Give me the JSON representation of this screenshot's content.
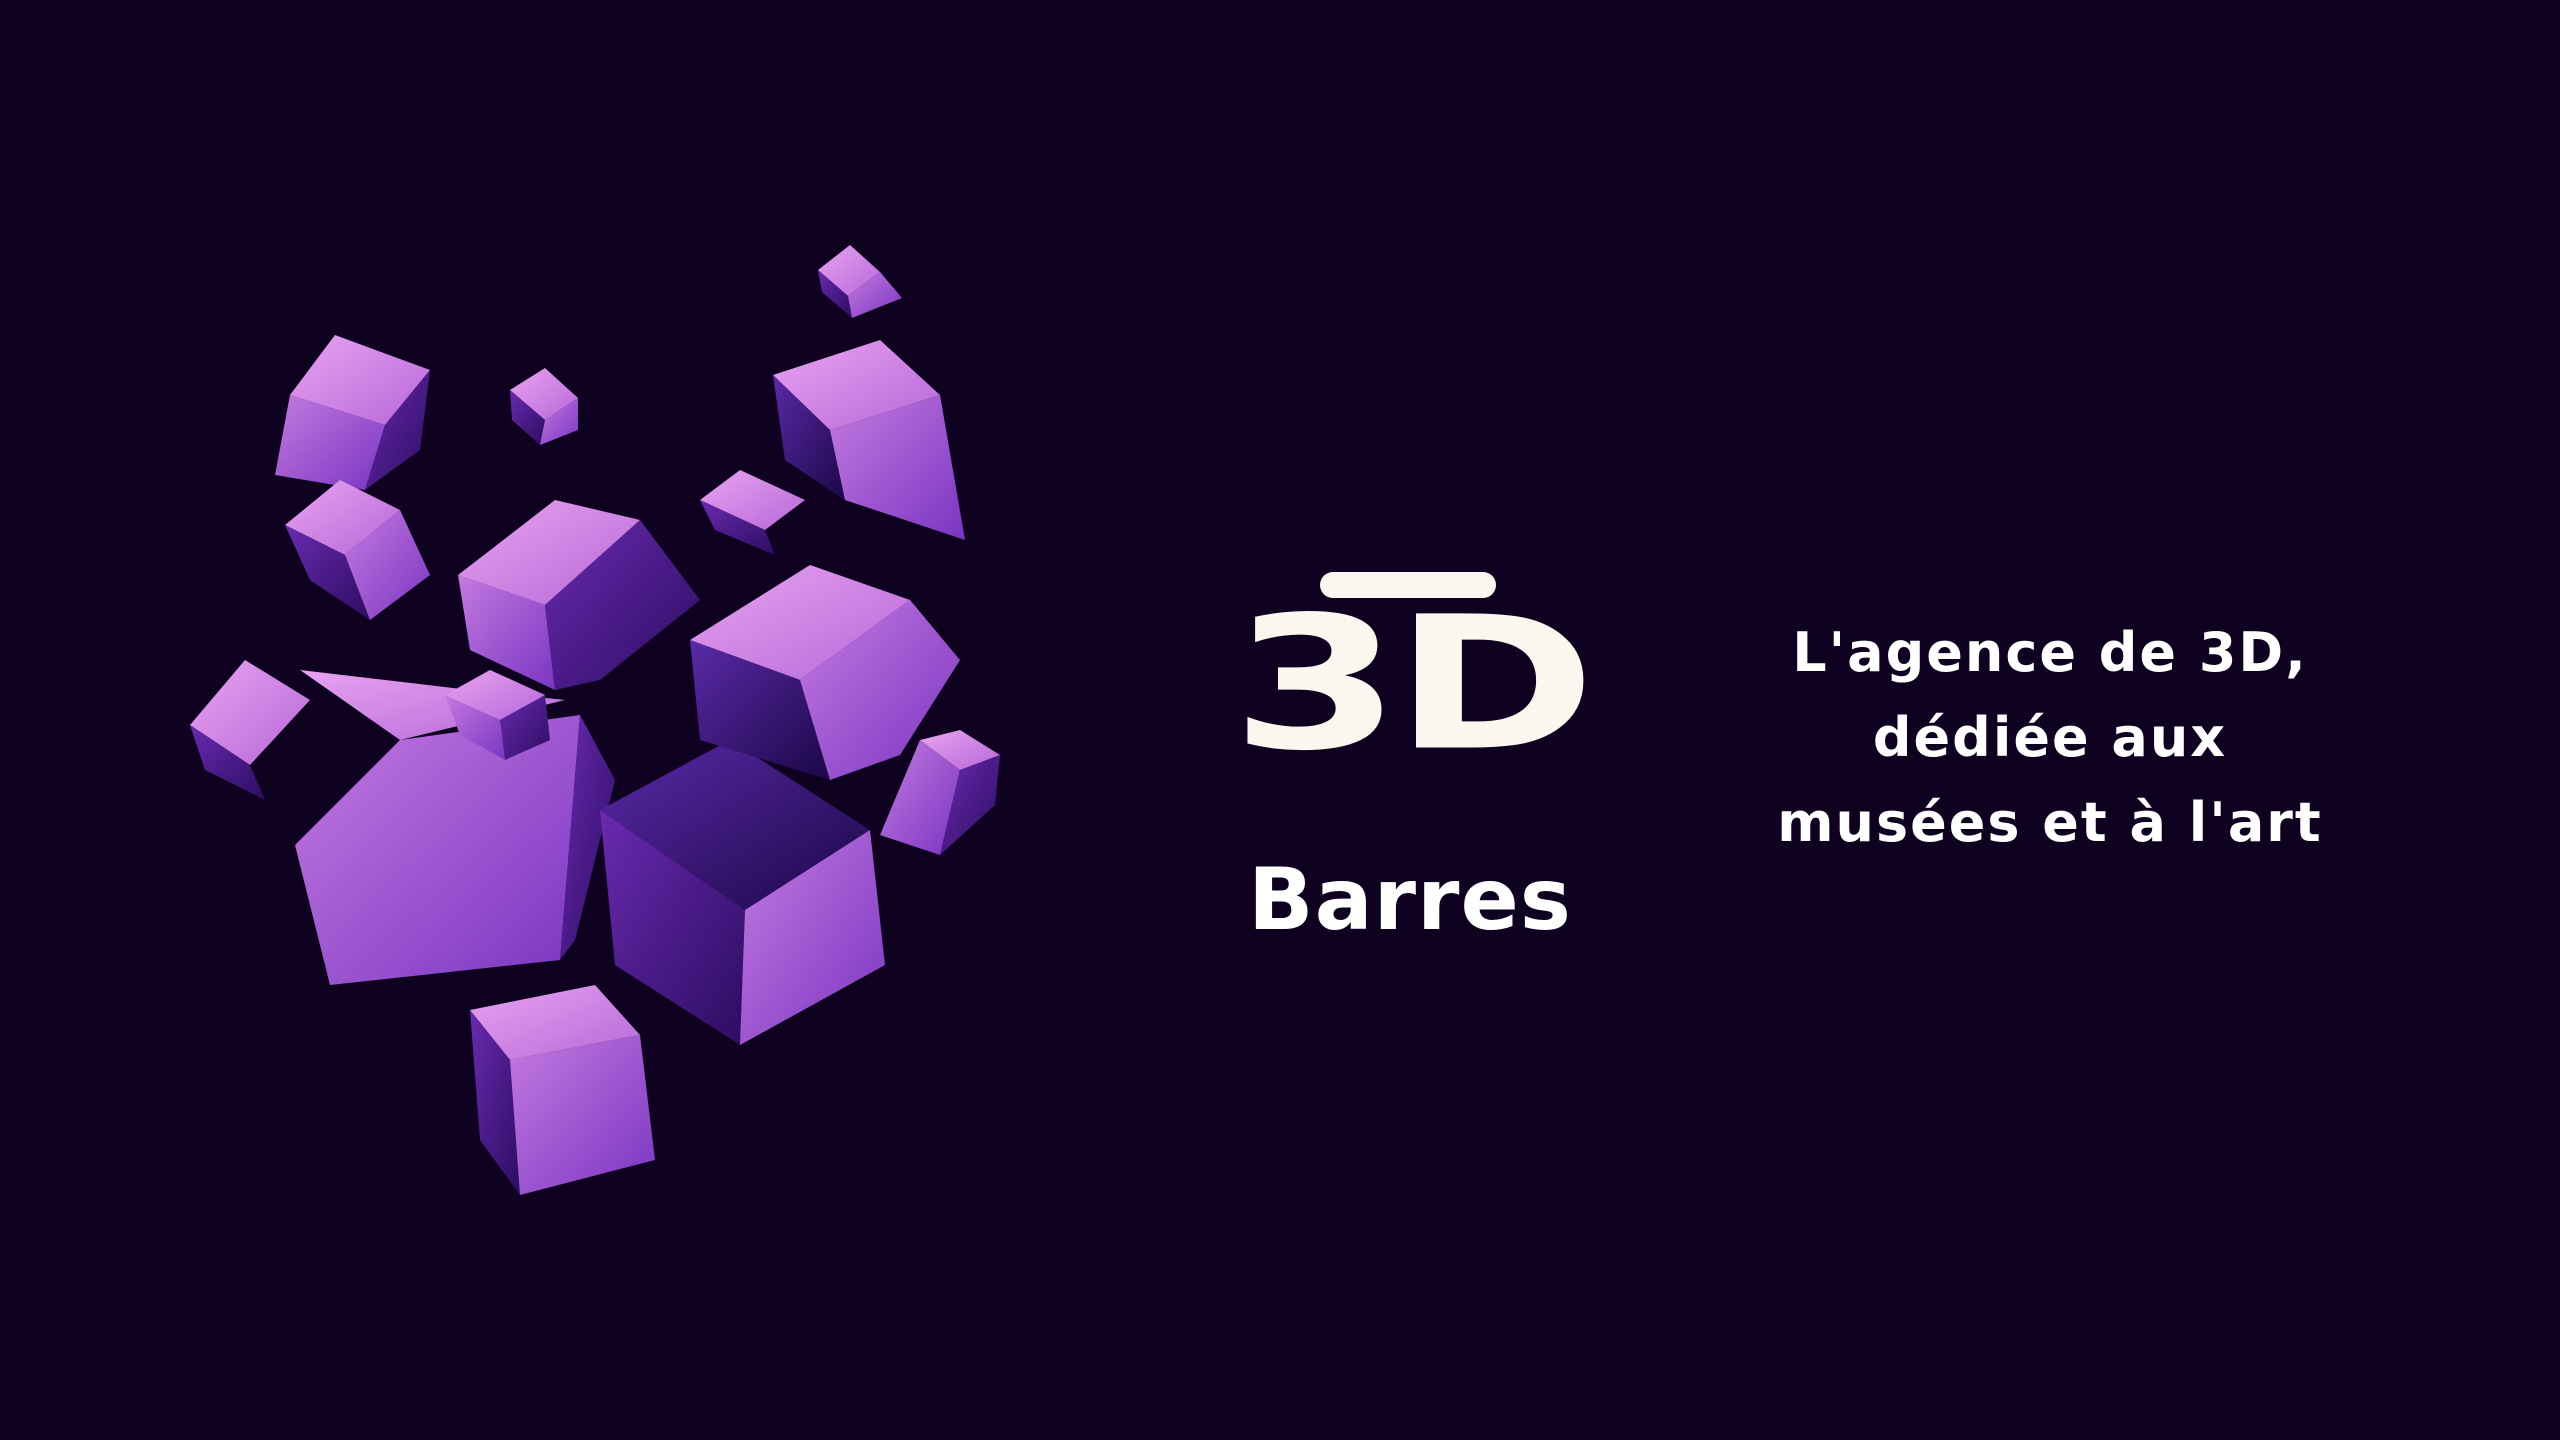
{
  "colors": {
    "background": "#0e0220",
    "cube_light": "#d78ce8",
    "cube_mid": "#9b4fd6",
    "cube_dark": "#4a1c8f",
    "logo_text": "#fbf7ef",
    "text": "#ffffff"
  },
  "logo": {
    "mark": "3D",
    "name": "Barres"
  },
  "tagline": {
    "lines": [
      "L'agence de 3D,",
      "dédiée aux",
      "musées et à l'art"
    ]
  },
  "illustration": {
    "icon": "floating-cubes-illustration"
  }
}
